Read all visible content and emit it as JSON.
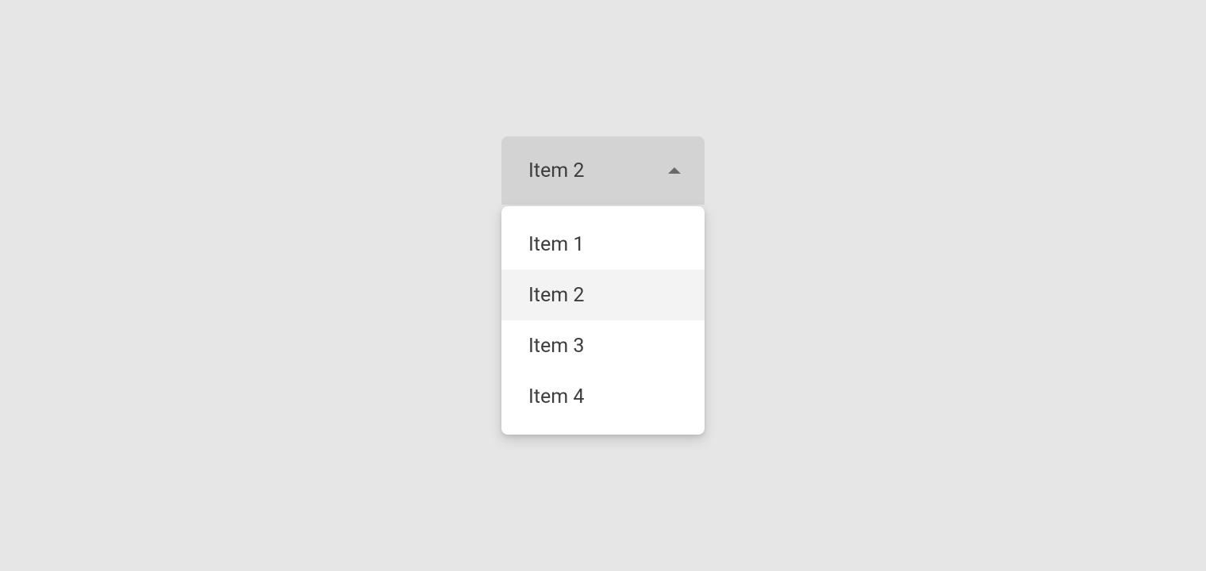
{
  "dropdown": {
    "selected_label": "Item 2",
    "selected_index": 1,
    "options": [
      {
        "label": "Item 1"
      },
      {
        "label": "Item 2"
      },
      {
        "label": "Item 3"
      },
      {
        "label": "Item 4"
      }
    ]
  }
}
